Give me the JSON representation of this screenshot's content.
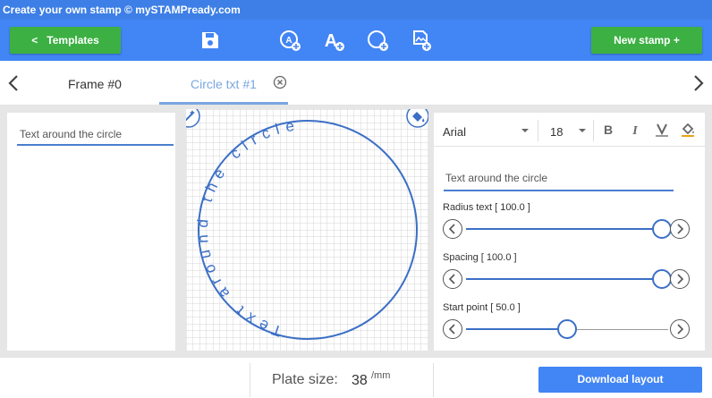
{
  "app": {
    "title": "Create your own stamp © mySTAMPready.com"
  },
  "toolbar": {
    "templates_label": "Templates",
    "templates_chevron": "<",
    "new_stamp_label": "New stamp +",
    "icons": [
      "save-icon",
      "add-circle-text-icon",
      "add-text-icon",
      "add-circle-icon",
      "add-image-icon"
    ]
  },
  "tabs": [
    {
      "label": "Frame #0",
      "active": false
    },
    {
      "label": "Circle txt #1",
      "active": true
    }
  ],
  "left_panel": {
    "text_value": "Text around the circle"
  },
  "canvas": {
    "circle_text": "Text around the circle",
    "icons": [
      "magic-wand-icon",
      "paint-bucket-icon"
    ]
  },
  "right_panel": {
    "font_name": "Arial",
    "font_size": "18",
    "format_buttons": [
      "bold-icon",
      "italic-icon",
      "text-color-icon",
      "fill-color-icon"
    ],
    "text_value": "Text around the circle",
    "sliders": [
      {
        "label": "Radius text [ 100.0 ]",
        "position": 0.97
      },
      {
        "label": "Spacing [ 100.0 ]",
        "position": 0.97
      },
      {
        "label": "Start point [ 50.0 ]",
        "position": 0.5
      }
    ]
  },
  "footer": {
    "plate_label": "Plate size:",
    "plate_value": "38",
    "plate_unit": "/mm",
    "download_label": "Download layout"
  },
  "colors": {
    "accent": "#4285f4",
    "green": "#3cb043",
    "slider": "#3b6fc6",
    "tab_active": "#7aa7e0"
  }
}
